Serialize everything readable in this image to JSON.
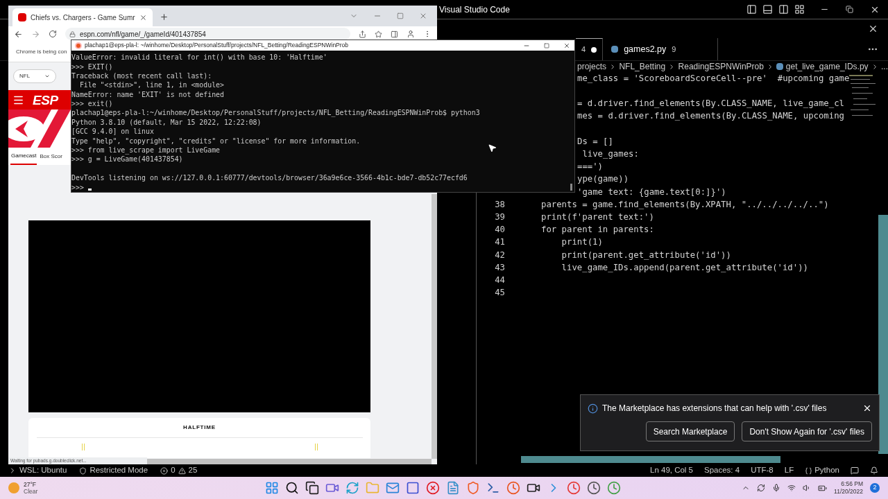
{
  "browser": {
    "tab_title": "Chiefs vs. Chargers - Game Sumr",
    "url": "espn.com/nfl/game/_/gameId/401437854",
    "info_bar": "Chrome is being con",
    "league_select": "NFL",
    "logo": "ESP",
    "page_tabs": [
      {
        "label": "Gamecast",
        "selected": true
      },
      {
        "label": "Box Scor",
        "selected": false
      }
    ],
    "game_status": "HALFTIME",
    "status_text": "Waiting for pubads.g.doubleclick.net..."
  },
  "terminal": {
    "title": "plachap1@eps-pla-l: ~/winhome/Desktop/PersonalStuff/projects/NFL_Betting/ReadingESPNWinProb",
    "lines": [
      {
        "kind": "text",
        "text": "ValueError: invalid literal for int() with base 10: 'Halftime'"
      },
      {
        "kind": "text",
        "text": ">>> EXIT()"
      },
      {
        "kind": "text",
        "text": "Traceback (most recent call last):"
      },
      {
        "kind": "text",
        "text": "  File \"<stdin>\", line 1, in <module>"
      },
      {
        "kind": "text",
        "text": "NameError: name 'EXIT' is not defined"
      },
      {
        "kind": "text",
        "text": ">>> exit()"
      },
      {
        "kind": "text",
        "text": "plachap1@eps-pla-l:~/winhome/Desktop/PersonalStuff/projects/NFL_Betting/ReadingESPNWinProb$ python3"
      },
      {
        "kind": "text",
        "text": "Python 3.8.10 (default, Mar 15 2022, 12:22:08)"
      },
      {
        "kind": "text",
        "text": "[GCC 9.4.0] on linux"
      },
      {
        "kind": "text",
        "text": "Type \"help\", \"copyright\", \"credits\" or \"license\" for more information."
      },
      {
        "kind": "text",
        "text": ">>> from live_scrape import LiveGame"
      },
      {
        "kind": "text",
        "text": ">>> g = LiveGame(401437854)"
      },
      {
        "kind": "blank"
      },
      {
        "kind": "text",
        "text": "DevTools listening on ws://127.0.0.1:60777/devtools/browser/36a9e6ce-3566-4b1c-bde7-db52c77ecfd6"
      },
      {
        "kind": "prompt",
        "text": ">>>"
      }
    ]
  },
  "editor": {
    "title": "Visual Studio Code",
    "tabs": [
      {
        "problems": "4",
        "modified": true,
        "selected": true
      },
      {
        "label": "games2.py",
        "problems": "9",
        "modified": false,
        "selected": false
      }
    ],
    "breadcrumbs": [
      "projects",
      "NFL_Betting",
      "ReadingESPNWinProb",
      "get_live_game_IDs.py",
      "..."
    ],
    "code": [
      {
        "kind": "text",
        "text": "me_class = 'ScoreboardScoreCell--pre'  #upcoming game"
      },
      {
        "kind": "blank"
      },
      {
        "kind": "text",
        "text": "= d.driver.find_elements(By.CLASS_NAME, live_game_cl"
      },
      {
        "kind": "text",
        "text": "mes = d.driver.find_elements(By.CLASS_NAME, upcoming"
      },
      {
        "kind": "blank"
      },
      {
        "kind": "text",
        "text": "Ds = []"
      },
      {
        "kind": "text",
        "text": " live_games:"
      },
      {
        "kind": "text",
        "text": "===')"
      },
      {
        "kind": "text",
        "text": "ype(game))"
      },
      {
        "kind": "text",
        "text": "'game text: {game.text[0:]}')"
      },
      {
        "kind": "numbered",
        "number": "38",
        "text": "parents = game.find_elements(By.XPATH, \"../../../../..\")"
      },
      {
        "kind": "numbered",
        "number": "39",
        "text": "print(f'parent text:')"
      },
      {
        "kind": "numbered",
        "number": "40",
        "text": "for parent in parents:"
      },
      {
        "kind": "numbered",
        "number": "41",
        "text": "    print(1)"
      },
      {
        "kind": "numbered",
        "number": "42",
        "text": "    print(parent.get_attribute('id'))"
      },
      {
        "kind": "numbered",
        "number": "43",
        "text": "    live_game_IDs.append(parent.get_attribute('id'))"
      },
      {
        "kind": "numbered",
        "number": "44"
      },
      {
        "kind": "numbered",
        "number": "45"
      }
    ],
    "notification": {
      "message": "The Marketplace has extensions that can help with '.csv' files",
      "buttons": [
        "Search Marketplace",
        "Don't Show Again for '.csv' files"
      ]
    },
    "status_left": {
      "remote": "WSL: Ubuntu",
      "mode": "Restricted Mode",
      "errors": "0",
      "warnings": "25"
    },
    "status_right": [
      "Ln 49, Col 5",
      "Spaces: 4",
      "UTF-8",
      "LF"
    ],
    "language": "Python"
  },
  "taskbar": {
    "temperature": "27°F",
    "weather": "Clear",
    "time": "6:56 PM",
    "date": "11/20/2022",
    "notifications": "2"
  }
}
